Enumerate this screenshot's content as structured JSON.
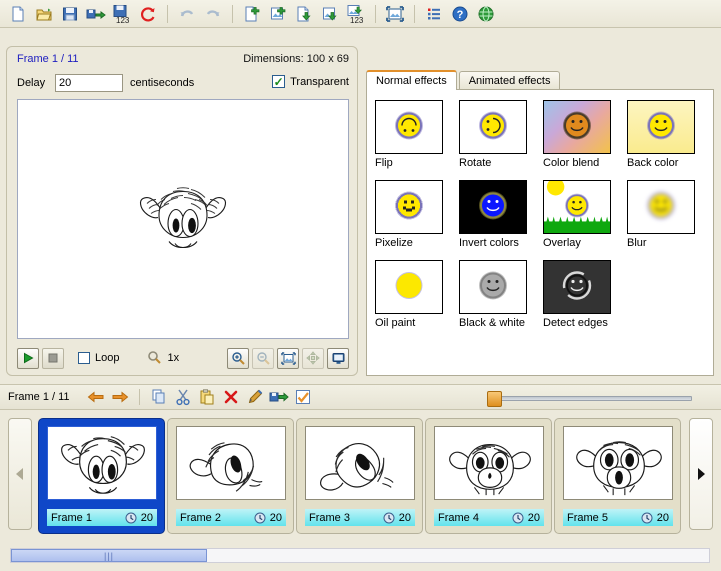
{
  "toolbar": {
    "buttons": [
      {
        "name": "new-file-icon",
        "title": "New",
        "enabled": true
      },
      {
        "name": "open-folder-icon",
        "title": "Open",
        "enabled": true
      },
      {
        "name": "save-icon",
        "title": "Save",
        "enabled": true
      },
      {
        "name": "save-as-icon",
        "title": "Save as",
        "enabled": true
      },
      {
        "name": "save-sequence-icon",
        "title": "Save sequence",
        "enabled": true
      },
      {
        "name": "refresh-icon",
        "title": "Reload",
        "enabled": true
      },
      {
        "name": "undo-icon",
        "title": "Undo",
        "enabled": false
      },
      {
        "name": "redo-icon",
        "title": "Redo",
        "enabled": false
      },
      {
        "name": "add-frame-icon",
        "title": "Add frame",
        "enabled": true
      },
      {
        "name": "add-image-icon",
        "title": "Add image",
        "enabled": true
      },
      {
        "name": "import-file-icon",
        "title": "Import",
        "enabled": true
      },
      {
        "name": "import-image-icon",
        "title": "Import image",
        "enabled": true
      },
      {
        "name": "import-sequence-icon",
        "title": "Import sequence",
        "enabled": true
      },
      {
        "name": "resize-icon",
        "title": "Resize",
        "enabled": true
      },
      {
        "name": "properties-icon",
        "title": "Properties",
        "enabled": true
      },
      {
        "name": "help-icon",
        "title": "Help",
        "enabled": true
      },
      {
        "name": "web-icon",
        "title": "Website",
        "enabled": true
      }
    ]
  },
  "preview": {
    "frame_label": "Frame 1 / 11",
    "dimensions_label": "Dimensions: 100 x 69",
    "delay_label": "Delay",
    "delay_value": "20",
    "delay_units": "centiseconds",
    "transparent_label": "Transparent",
    "transparent_checked": true,
    "loop_label": "Loop",
    "loop_checked": false,
    "zoom_label": "1x",
    "controls": [
      {
        "name": "play-button",
        "enabled": true
      },
      {
        "name": "stop-button",
        "enabled": true
      },
      {
        "name": "zoom-in-button",
        "enabled": true
      },
      {
        "name": "zoom-out-button",
        "enabled": false
      },
      {
        "name": "fit-to-window-button",
        "enabled": true
      },
      {
        "name": "pan-button",
        "enabled": false
      },
      {
        "name": "full-screen-button",
        "enabled": true
      }
    ]
  },
  "effects": {
    "tabs": [
      {
        "label": "Normal effects",
        "active": true
      },
      {
        "label": "Animated effects",
        "active": false
      }
    ],
    "items": [
      {
        "label": "Flip",
        "name": "effect-flip"
      },
      {
        "label": "Rotate",
        "name": "effect-rotate"
      },
      {
        "label": "Color blend",
        "name": "effect-color-blend"
      },
      {
        "label": "Back color",
        "name": "effect-back-color"
      },
      {
        "label": "Pixelize",
        "name": "effect-pixelize"
      },
      {
        "label": "Invert colors",
        "name": "effect-invert-colors"
      },
      {
        "label": "Overlay",
        "name": "effect-overlay"
      },
      {
        "label": "Blur",
        "name": "effect-blur"
      },
      {
        "label": "Oil paint",
        "name": "effect-oil-paint"
      },
      {
        "label": "Black & white",
        "name": "effect-black-and-white"
      },
      {
        "label": "Detect edges",
        "name": "effect-detect-edges"
      }
    ]
  },
  "strip": {
    "frame_label": "Frame 1 / 11",
    "buttons": [
      {
        "name": "previous-frame-button"
      },
      {
        "name": "next-frame-button"
      },
      {
        "name": "copy-button"
      },
      {
        "name": "cut-button"
      },
      {
        "name": "paste-button"
      },
      {
        "name": "delete-button"
      },
      {
        "name": "edit-button"
      },
      {
        "name": "export-button"
      },
      {
        "name": "select-all-button"
      }
    ],
    "frames": [
      {
        "name": "Frame 1",
        "delay": "20",
        "selected": true
      },
      {
        "name": "Frame 2",
        "delay": "20",
        "selected": false
      },
      {
        "name": "Frame 3",
        "delay": "20",
        "selected": false
      },
      {
        "name": "Frame 4",
        "delay": "20",
        "selected": false
      },
      {
        "name": "Frame 5",
        "delay": "20",
        "selected": false
      }
    ]
  },
  "colors": {
    "window_bg": "#ECE9DB",
    "selection_blue": "#0F47C8",
    "caption_cyan": "#62E3EC",
    "accent_orange": "#E2902C",
    "link_blue": "#2020C0"
  }
}
